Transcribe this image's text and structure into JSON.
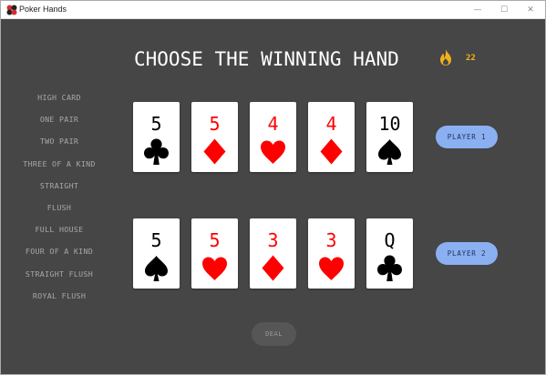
{
  "window": {
    "title": "Poker Hands",
    "controls": {
      "minimize": "—",
      "maximize": "☐",
      "close": "✕"
    }
  },
  "header": {
    "headline": "CHOOSE THE WINNING HAND",
    "streak_icon": "flame-icon",
    "streak_count": "22"
  },
  "hand_rankings": [
    "HIGH CARD",
    "ONE PAIR",
    "TWO PAIR",
    "THREE OF A KIND",
    "STRAIGHT",
    "FLUSH",
    "FULL HOUSE",
    "FOUR OF A KIND",
    "STRAIGHT FLUSH",
    "ROYAL FLUSH"
  ],
  "players": [
    {
      "button_label": "PLAYER 1",
      "cards": [
        {
          "rank": "5",
          "suit": "clubs",
          "color": "#000000"
        },
        {
          "rank": "5",
          "suit": "diamonds",
          "color": "#ff0000"
        },
        {
          "rank": "4",
          "suit": "hearts",
          "color": "#ff0000"
        },
        {
          "rank": "4",
          "suit": "diamonds",
          "color": "#ff0000"
        },
        {
          "rank": "10",
          "suit": "spades",
          "color": "#000000"
        }
      ]
    },
    {
      "button_label": "PLAYER 2",
      "cards": [
        {
          "rank": "5",
          "suit": "spades",
          "color": "#000000"
        },
        {
          "rank": "5",
          "suit": "hearts",
          "color": "#ff0000"
        },
        {
          "rank": "3",
          "suit": "diamonds",
          "color": "#ff0000"
        },
        {
          "rank": "3",
          "suit": "hearts",
          "color": "#ff0000"
        },
        {
          "rank": "Q",
          "suit": "clubs",
          "color": "#000000"
        }
      ]
    }
  ],
  "actions": {
    "deal_label": "DEAL"
  },
  "colors": {
    "background": "#464646",
    "accent_button": "#8ab0f2",
    "streak": "#f2b21a"
  }
}
